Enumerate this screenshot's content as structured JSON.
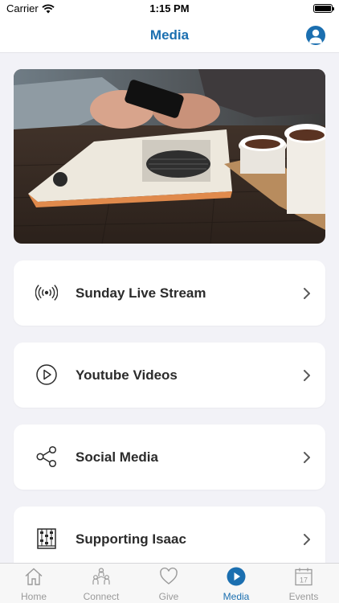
{
  "status_bar": {
    "carrier": "Carrier",
    "time": "1:15 PM"
  },
  "nav": {
    "title": "Media"
  },
  "menu": [
    {
      "label": "Sunday Live Stream",
      "icon": "live-stream-icon"
    },
    {
      "label": "Youtube Videos",
      "icon": "play-circle-icon"
    },
    {
      "label": "Social Media",
      "icon": "share-icon"
    },
    {
      "label": "Supporting Isaac",
      "icon": "abacus-icon"
    }
  ],
  "tabs": [
    {
      "label": "Home",
      "icon": "home-icon"
    },
    {
      "label": "Connect",
      "icon": "people-icon"
    },
    {
      "label": "Give",
      "icon": "heart-icon"
    },
    {
      "label": "Media",
      "icon": "play-icon",
      "active": true
    },
    {
      "label": "Events",
      "icon": "calendar-icon",
      "calendar_day": "17"
    }
  ],
  "colors": {
    "accent": "#1b6fb0",
    "background": "#f2f2f7",
    "inactive": "#9a9a9a"
  }
}
